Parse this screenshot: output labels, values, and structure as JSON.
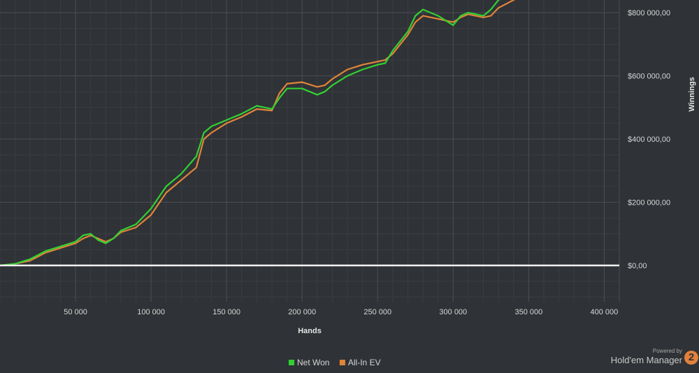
{
  "chart_data": {
    "type": "line",
    "xlabel": "Hands",
    "ylabel": "Winnings",
    "xlim": [
      0,
      410000
    ],
    "ylim": [
      -115000,
      840000
    ],
    "x_ticks": [
      50000,
      100000,
      150000,
      200000,
      250000,
      300000,
      350000,
      400000
    ],
    "x_tick_labels": [
      "50 000",
      "100 000",
      "150 000",
      "200 000",
      "250 000",
      "300 000",
      "350 000",
      "400 000"
    ],
    "y_ticks": [
      0,
      200000,
      400000,
      600000,
      800000
    ],
    "y_tick_labels": [
      "$0,00",
      "$200 000,00",
      "$400 000,00",
      "$600 000,00",
      "$800 000,00"
    ],
    "zero_line": true,
    "grid": true,
    "legend_position": "bottom-center",
    "series": [
      {
        "name": "Net Won",
        "color": "#33d033",
        "x": [
          0,
          10000,
          20000,
          30000,
          40000,
          50000,
          55000,
          60000,
          65000,
          70000,
          75000,
          80000,
          90000,
          100000,
          110000,
          120000,
          130000,
          135000,
          140000,
          150000,
          160000,
          170000,
          180000,
          185000,
          190000,
          200000,
          210000,
          215000,
          220000,
          230000,
          240000,
          250000,
          255000,
          260000,
          270000,
          275000,
          280000,
          290000,
          300000,
          305000,
          310000,
          320000,
          325000,
          330000,
          340000,
          345000,
          350000
        ],
        "y": [
          0,
          5000,
          20000,
          45000,
          60000,
          75000,
          95000,
          100000,
          80000,
          70000,
          85000,
          110000,
          130000,
          180000,
          250000,
          290000,
          345000,
          420000,
          440000,
          460000,
          480000,
          505000,
          495000,
          530000,
          560000,
          560000,
          540000,
          550000,
          570000,
          600000,
          620000,
          635000,
          640000,
          680000,
          740000,
          790000,
          810000,
          790000,
          760000,
          790000,
          800000,
          790000,
          810000,
          840000,
          860000,
          870000,
          880000
        ]
      },
      {
        "name": "All-In EV",
        "color": "#e0843a",
        "x": [
          0,
          10000,
          20000,
          30000,
          40000,
          50000,
          55000,
          60000,
          65000,
          70000,
          75000,
          80000,
          90000,
          100000,
          110000,
          120000,
          130000,
          135000,
          140000,
          150000,
          160000,
          170000,
          180000,
          185000,
          190000,
          200000,
          210000,
          215000,
          220000,
          230000,
          240000,
          250000,
          255000,
          260000,
          270000,
          275000,
          280000,
          290000,
          300000,
          305000,
          310000,
          320000,
          325000,
          330000,
          340000,
          345000,
          350000
        ],
        "y": [
          0,
          5000,
          15000,
          40000,
          55000,
          70000,
          85000,
          95000,
          85000,
          75000,
          85000,
          105000,
          120000,
          160000,
          230000,
          270000,
          310000,
          400000,
          420000,
          450000,
          470000,
          495000,
          490000,
          545000,
          575000,
          580000,
          565000,
          570000,
          590000,
          620000,
          635000,
          645000,
          650000,
          670000,
          730000,
          770000,
          790000,
          780000,
          770000,
          785000,
          795000,
          785000,
          790000,
          815000,
          840000,
          850000,
          860000
        ]
      }
    ]
  },
  "branding": {
    "powered_by": "Powered by",
    "product": "Hold'em Manager",
    "badge": "2"
  }
}
